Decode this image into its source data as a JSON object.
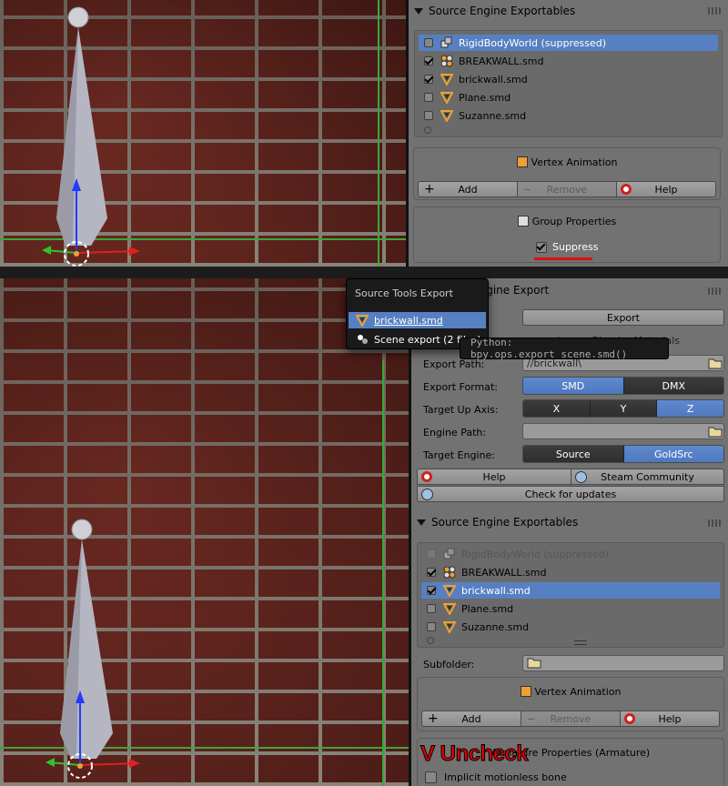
{
  "top": {
    "header": "Source Engine Exportables",
    "exportables": [
      {
        "label": "RigidBodyWorld (suppressed)",
        "icon": "group-icon",
        "checked": false,
        "selected": true
      },
      {
        "label": "BREAKWALL.smd",
        "icon": "fracture-icon",
        "checked": true,
        "selected": false
      },
      {
        "label": "brickwall.smd",
        "icon": "mesh-icon",
        "checked": true,
        "selected": false
      },
      {
        "label": "Plane.smd",
        "icon": "mesh-icon",
        "checked": false,
        "selected": false
      },
      {
        "label": "Suzanne.smd",
        "icon": "mesh-icon",
        "checked": false,
        "selected": false
      }
    ],
    "vertex_animation": "Vertex Animation",
    "add": "Add",
    "remove": "Remove",
    "help": "Help",
    "group_properties": "Group Properties",
    "suppress": "Suppress",
    "suppress_checked": true
  },
  "menu": {
    "title": "Source Tools Export",
    "items": [
      "brickwall.smd",
      "Scene export (2 files)"
    ],
    "tooltip": "Python: bpy.ops.export_scene.smd()"
  },
  "bottom": {
    "header": "Source Engine Export",
    "export_button": "Export",
    "partial_left": "Ignore Blender Materials",
    "export_path_label": "Export Path:",
    "export_path_value": "//brickwall\\",
    "export_format_label": "Export Format:",
    "export_format_options": [
      "SMD",
      "DMX"
    ],
    "export_format_selected": "SMD",
    "target_up_axis_label": "Target Up Axis:",
    "axis_options": [
      "X",
      "Y",
      "Z"
    ],
    "axis_selected": "Z",
    "engine_path_label": "Engine Path:",
    "engine_path_value": "",
    "target_engine_label": "Target Engine:",
    "engine_options": [
      "Source",
      "GoldSrc"
    ],
    "engine_selected": "GoldSrc",
    "help": "Help",
    "steam_community": "Steam Community",
    "check_updates": "Check for updates",
    "exportables_header": "Source Engine Exportables",
    "exportables": [
      {
        "label": "RigidBodyWorld (suppressed)",
        "icon": "group-icon",
        "checked": false,
        "selected": false,
        "dim": true
      },
      {
        "label": "BREAKWALL.smd",
        "icon": "fracture-icon",
        "checked": true,
        "selected": false,
        "dim": false
      },
      {
        "label": "brickwall.smd",
        "icon": "mesh-icon",
        "checked": true,
        "selected": true,
        "dim": false
      },
      {
        "label": "Plane.smd",
        "icon": "mesh-icon",
        "checked": false,
        "selected": false,
        "dim": false
      },
      {
        "label": "Suzanne.smd",
        "icon": "mesh-icon",
        "checked": false,
        "selected": false,
        "dim": false
      }
    ],
    "subfolder_label": "Subfolder:",
    "vertex_animation": "Vertex Animation",
    "add": "Add",
    "remove": "Remove",
    "armature_properties": "Armature Properties (Armature)",
    "implicit_motionless": "Implicit motionless bone",
    "annotation": "V Uncheck"
  },
  "colors": {
    "selection": "#5680c2",
    "panel": "#727272",
    "annotation": "#e00000"
  }
}
